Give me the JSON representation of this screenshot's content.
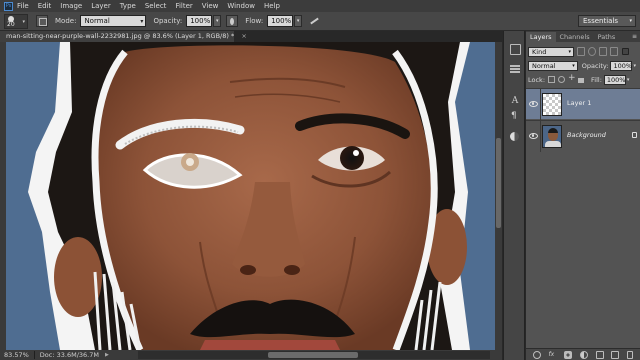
{
  "menubar": {
    "logo": "Ps",
    "items": [
      "File",
      "Edit",
      "Image",
      "Layer",
      "Type",
      "Select",
      "Filter",
      "View",
      "Window",
      "Help"
    ]
  },
  "options": {
    "brush_size": "20",
    "mode_label": "Mode:",
    "mode_value": "Normal",
    "opacity_label": "Opacity:",
    "opacity_value": "100%",
    "flow_label": "Flow:",
    "flow_value": "100%",
    "workspace": "Essentials"
  },
  "document": {
    "tab_title": "man-sitting-near-purple-wall-2232981.jpg @ 83.6% (Layer 1, RGB/8) *",
    "close_glyph": "×"
  },
  "status": {
    "zoom": "83.57%",
    "doc_size": "Doc: 33.6M/36.7M",
    "arrow": "▶"
  },
  "layers_panel": {
    "tabs": [
      "Layers",
      "Channels",
      "Paths"
    ],
    "active_tab": "Layers",
    "filter_kind": "Kind",
    "blend_mode": "Normal",
    "opacity_label": "Opacity:",
    "opacity_value": "100%",
    "lock_label": "Lock:",
    "fill_label": "Fill:",
    "fill_value": "100%",
    "layers": [
      {
        "name": "Layer 1",
        "selected": true,
        "visible": true
      },
      {
        "name": "Background",
        "selected": false,
        "visible": true,
        "locked": true
      }
    ]
  },
  "colors": {
    "app_bg": "#282828",
    "panel_bg": "#535353",
    "selected_layer": "#6e7d95",
    "photo_backdrop": "#4f6d91"
  }
}
